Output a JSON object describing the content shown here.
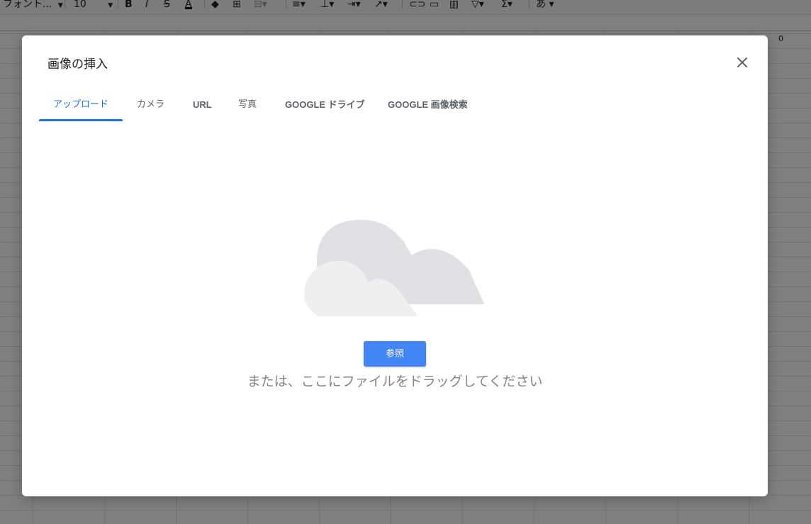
{
  "toolbar": {
    "font_name": "フォント...",
    "font_size": "10",
    "bold": "B",
    "italic": "I",
    "strikethrough": "S",
    "text_color": "A",
    "ime": "あ",
    "sigma": "Σ"
  },
  "sheet": {
    "column_head_value": "0"
  },
  "dialog": {
    "title": "画像の挿入",
    "tabs": [
      {
        "label": "アップロード",
        "active": true
      },
      {
        "label": "カメラ",
        "active": false
      },
      {
        "label": "URL",
        "active": false
      },
      {
        "label": "写真",
        "active": false
      },
      {
        "label": "GOOGLE ドライブ",
        "active": false
      },
      {
        "label": "GOOGLE 画像検索",
        "active": false
      }
    ],
    "browse_label": "参照",
    "drop_hint": "または、ここにファイルをドラッグしてください"
  },
  "icons": {
    "close": "close-icon",
    "upload_illustration": "cloud-illustration-icon"
  },
  "colors": {
    "accent": "#1a73e8",
    "button": "#4285f4",
    "cloud_back": "#dfe0e4",
    "cloud_front": "#eeeff1"
  }
}
